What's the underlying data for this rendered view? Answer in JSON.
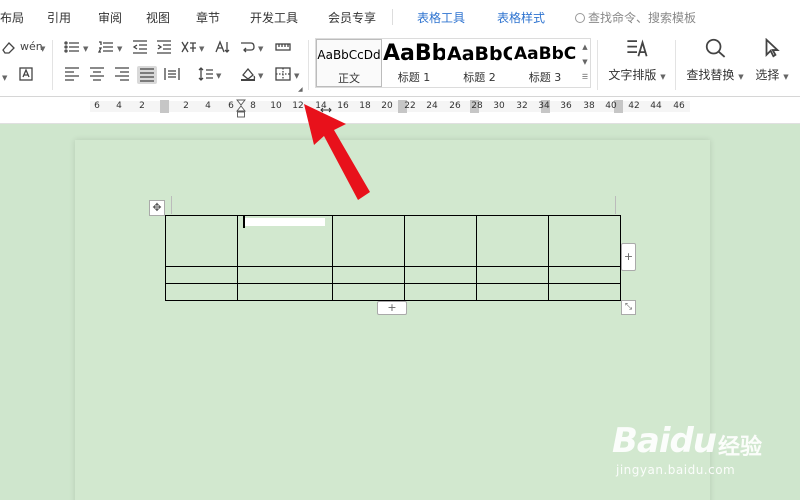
{
  "menu": {
    "tabs": [
      "布局",
      "引用",
      "审阅",
      "视图",
      "章节",
      "开发工具",
      "会员专享",
      "表格工具",
      "表格样式"
    ],
    "search_placeholder": "查找命令、搜索模板"
  },
  "ribbon": {
    "styles": [
      {
        "preview": "AaBbCcDd",
        "name": "正文"
      },
      {
        "preview": "AaBb",
        "name": "标题 1"
      },
      {
        "preview": "AaBbC",
        "name": "标题 2"
      },
      {
        "preview": "AaBbC",
        "name": "标题 3"
      }
    ],
    "text_layout_label": "文字排版",
    "find_replace_label": "查找替换",
    "select_label": "选择",
    "phonetic_char": "wén"
  },
  "ruler": {
    "numbers": [
      "6",
      "4",
      "2",
      "2",
      "4",
      "6",
      "8",
      "10",
      "12",
      "14",
      "16",
      "18",
      "20",
      "22",
      "24",
      "26",
      "28",
      "30",
      "32",
      "34",
      "36",
      "38",
      "40",
      "42",
      "44",
      "46"
    ]
  },
  "table": {
    "handles": {
      "add_column": "+",
      "add_row": "+",
      "move": "✥",
      "resize": "⤡"
    }
  },
  "watermark": {
    "brand": "Baidu",
    "product": "经验",
    "url": "jingyan.baidu.com"
  },
  "colors": {
    "accent": "#2f74d0",
    "doc_background": "#cfe6cd",
    "arrow": "#e8111b"
  }
}
